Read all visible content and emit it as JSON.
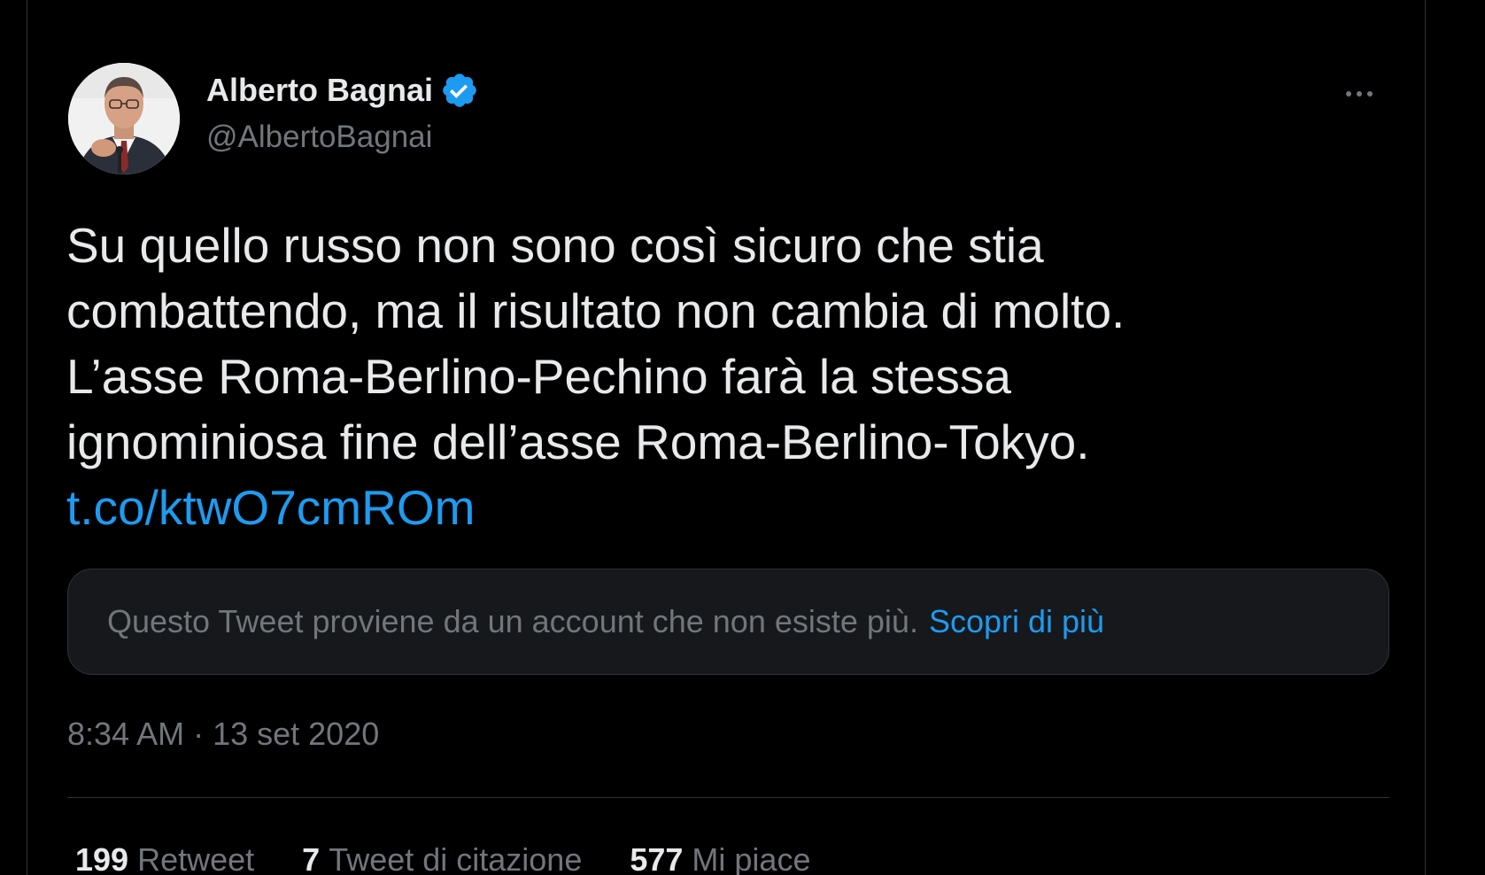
{
  "user": {
    "display_name": "Alberto Bagnai",
    "handle": "@AlbertoBagnai",
    "verified_icon": "verified-badge-icon"
  },
  "tweet": {
    "lines": [
      "Su quello russo non sono così sicuro che stia",
      "combattendo, ma il risultato non cambia di molto.",
      "L’asse Roma-Berlino-Pechino farà la stessa",
      "ignominiosa fine dell’asse Roma-Berlino-Tokyo."
    ],
    "link": "t.co/ktwO7cmROm"
  },
  "quoted_notice": {
    "text": "Questo Tweet proviene da un account che non esiste più.",
    "link_label": "Scopri di più"
  },
  "timestamp": "8:34 AM · 13 set 2020",
  "stats": {
    "retweets": {
      "count": "199",
      "label": "Retweet"
    },
    "quotes": {
      "count": "7",
      "label": "Tweet di citazione"
    },
    "likes": {
      "count": "577",
      "label": "Mi piace"
    }
  },
  "colors": {
    "background": "#000000",
    "text": "#e7e9ea",
    "secondary": "#71767b",
    "accent": "#1d9bf0",
    "card": "#16181c",
    "border": "#2f3336"
  }
}
